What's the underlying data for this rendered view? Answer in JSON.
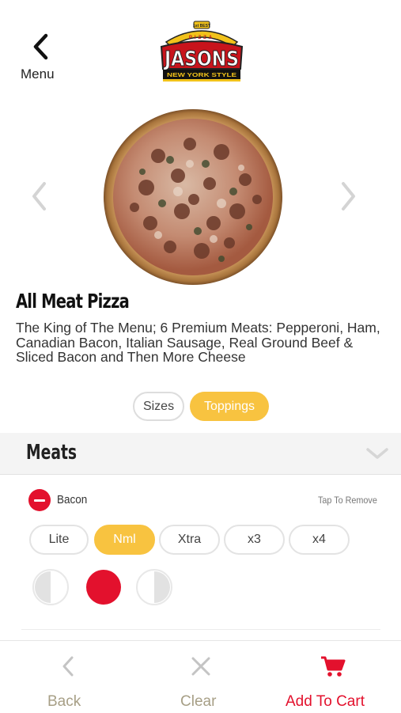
{
  "header": {
    "back_label": "Menu",
    "logo": {
      "top_text": "1st BEST",
      "arc_text": "PIZZA",
      "brand": "JASONS",
      "tagline": "NEW YORK STYLE"
    }
  },
  "product": {
    "image_icon": "pizza-image",
    "title": "All Meat Pizza",
    "description": "The King of The Menu; 6 Premium Meats: Pepperoni, Ham, Canadian Bacon, Italian Sausage, Real Ground Beef & Sliced Bacon and Then More Cheese"
  },
  "tabs": [
    {
      "label": "Sizes",
      "active": false
    },
    {
      "label": "Toppings",
      "active": true
    }
  ],
  "section": {
    "title": "Meats",
    "icon": "chevron-down-icon"
  },
  "topping": {
    "name": "Bacon",
    "hint": "Tap To Remove",
    "amounts": [
      {
        "label": "Lite",
        "selected": false
      },
      {
        "label": "Nml",
        "selected": true
      },
      {
        "label": "Xtra",
        "selected": false
      },
      {
        "label": "x3",
        "selected": false
      },
      {
        "label": "x4",
        "selected": false
      }
    ],
    "portions": [
      "left-half",
      "whole",
      "right-half"
    ],
    "selected_portion": "whole"
  },
  "bottom_bar": {
    "back_label": "Back",
    "clear_label": "Clear",
    "add_label": "Add To Cart"
  },
  "colors": {
    "accent_yellow": "#f8c340",
    "brand_red": "#e3112d",
    "muted_gray": "#b8b8b8",
    "muted_label": "#a79f86"
  }
}
